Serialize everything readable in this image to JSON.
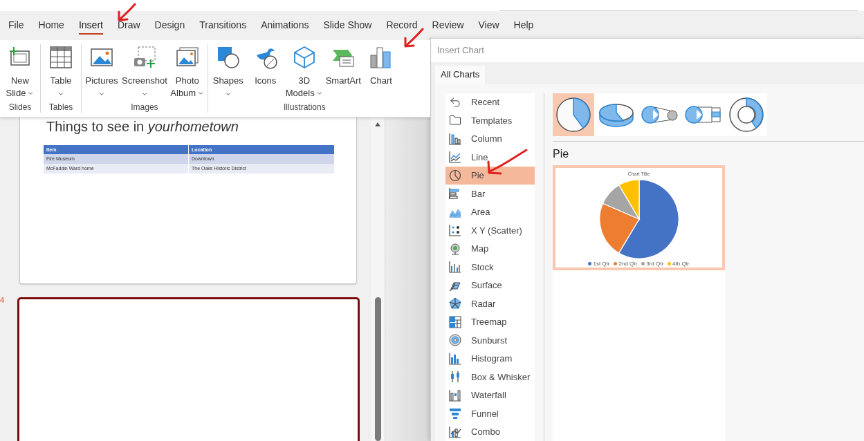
{
  "menu_tabs": [
    {
      "label": "File",
      "selected": false
    },
    {
      "label": "Home",
      "selected": false
    },
    {
      "label": "Insert",
      "selected": true
    },
    {
      "label": "Draw",
      "selected": false
    },
    {
      "label": "Design",
      "selected": false
    },
    {
      "label": "Transitions",
      "selected": false
    },
    {
      "label": "Animations",
      "selected": false
    },
    {
      "label": "Slide Show",
      "selected": false
    },
    {
      "label": "Record",
      "selected": false
    },
    {
      "label": "Review",
      "selected": false
    },
    {
      "label": "View",
      "selected": false
    },
    {
      "label": "Help",
      "selected": false
    }
  ],
  "ribbon_groups": [
    {
      "label": "Slides",
      "buttons": [
        {
          "lines": [
            "New",
            "Slide"
          ],
          "dropdown": true
        }
      ]
    },
    {
      "label": "Tables",
      "buttons": [
        {
          "lines": [
            "Table"
          ],
          "dropdown": true
        }
      ]
    },
    {
      "label": "Images",
      "buttons": [
        {
          "lines": [
            "Pictures"
          ],
          "dropdown": true
        },
        {
          "lines": [
            "Screenshot"
          ],
          "dropdown": true
        },
        {
          "lines": [
            "Photo",
            "Album"
          ],
          "dropdown": true
        }
      ]
    },
    {
      "label": "Illustrations",
      "buttons": [
        {
          "lines": [
            "Shapes"
          ],
          "dropdown": true
        },
        {
          "lines": [
            "Icons"
          ],
          "dropdown": false
        },
        {
          "lines": [
            "3D",
            "Models"
          ],
          "dropdown": true
        },
        {
          "lines": [
            "SmartArt"
          ],
          "dropdown": false
        },
        {
          "lines": [
            "Chart"
          ],
          "dropdown": false
        }
      ]
    }
  ],
  "slides": [
    {
      "title": "Things to see in *yourhometown*",
      "table": {
        "columns": [
          "Item",
          "Location"
        ],
        "rows": [
          [
            "Fire Museum",
            "Downtown"
          ],
          [
            "McFaddin Ward home",
            "The Oaks Historic District"
          ]
        ]
      },
      "selected": false
    },
    {
      "number": "4",
      "selected": true
    }
  ],
  "dialog": {
    "title": "Insert Chart",
    "tabs": [
      {
        "label": "All Charts",
        "selected": true
      }
    ],
    "chart_types": [
      {
        "label": "Recent",
        "selected": false
      },
      {
        "label": "Templates",
        "selected": false
      },
      {
        "label": "Column",
        "selected": false
      },
      {
        "label": "Line",
        "selected": false
      },
      {
        "label": "Pie",
        "selected": true
      },
      {
        "label": "Bar",
        "selected": false
      },
      {
        "label": "Area",
        "selected": false
      },
      {
        "label": "X Y (Scatter)",
        "selected": false
      },
      {
        "label": "Map",
        "selected": false
      },
      {
        "label": "Stock",
        "selected": false
      },
      {
        "label": "Surface",
        "selected": false
      },
      {
        "label": "Radar",
        "selected": false
      },
      {
        "label": "Treemap",
        "selected": false
      },
      {
        "label": "Sunburst",
        "selected": false
      },
      {
        "label": "Histogram",
        "selected": false
      },
      {
        "label": "Box & Whisker",
        "selected": false
      },
      {
        "label": "Waterfall",
        "selected": false
      },
      {
        "label": "Funnel",
        "selected": false
      },
      {
        "label": "Combo",
        "selected": false
      }
    ],
    "subtypes": [
      {
        "selected": true
      },
      {
        "selected": false
      },
      {
        "selected": false
      },
      {
        "selected": false
      },
      {
        "selected": false
      }
    ],
    "heading": "Pie",
    "preview": {
      "title": "Chart Title",
      "legend": [
        {
          "label": "1st Qtr",
          "color": "#4472c4"
        },
        {
          "label": "2nd Qtr",
          "color": "#ed7d31"
        },
        {
          "label": "3rd Qtr",
          "color": "#a5a5a5"
        },
        {
          "label": "4th Qtr",
          "color": "#ffc000"
        }
      ]
    }
  }
}
